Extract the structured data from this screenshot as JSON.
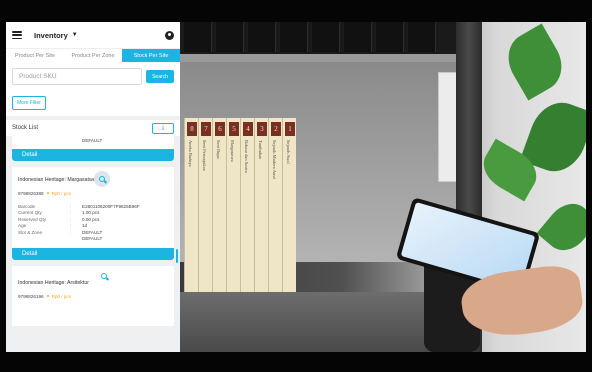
{
  "app": {
    "title": "Inventory",
    "tabs": [
      {
        "label": "Product Per Site",
        "active": false
      },
      {
        "label": "Product Per Zone",
        "active": false
      },
      {
        "label": "Stock Per Site",
        "active": true
      }
    ],
    "search": {
      "placeholder": "Product SKU",
      "button": "Search"
    },
    "filter_button": "More Filter",
    "stock_list_title": "Stock List",
    "cards": [
      {
        "partial_rows": [
          {
            "value": "DEFAULT"
          }
        ],
        "detail_label": "Detail"
      },
      {
        "name": "Indonesian Heritage: Margasatwa",
        "sku": "9798826388",
        "price": "Rp0 / pcs",
        "rows": [
          {
            "label": "Barcode",
            "value": "E2801105200F7F9625B96F"
          },
          {
            "label": "Current Qty",
            "value": "1.00 pcs"
          },
          {
            "label": "Reserved Qty",
            "value": "0.00 pcs"
          },
          {
            "label": "Age",
            "value": "1d"
          },
          {
            "label": "Slot & Zone",
            "value": "DEFAULT"
          },
          {
            "label": "",
            "value": "DEFAULT"
          }
        ],
        "detail_label": "Detail"
      },
      {
        "name": "Indonesian Heritage: Arsitektur",
        "sku": "9798826196",
        "price": "Rp0 / pcs"
      }
    ],
    "colors": {
      "accent": "#1cb4e0",
      "price": "#f5a623"
    }
  },
  "scene": {
    "book_numbers": [
      "8",
      "7",
      "6",
      "5",
      "4",
      "3",
      "2",
      "1"
    ],
    "book_titles": [
      "Aneka Budaya",
      "Seni Pertunjukan",
      "Seni Rupa",
      "Margasatwa",
      "Bahasa dan Sastra",
      "Tumbuhan",
      "Sejarah Modern Awal",
      "Sejarah Awal"
    ]
  }
}
